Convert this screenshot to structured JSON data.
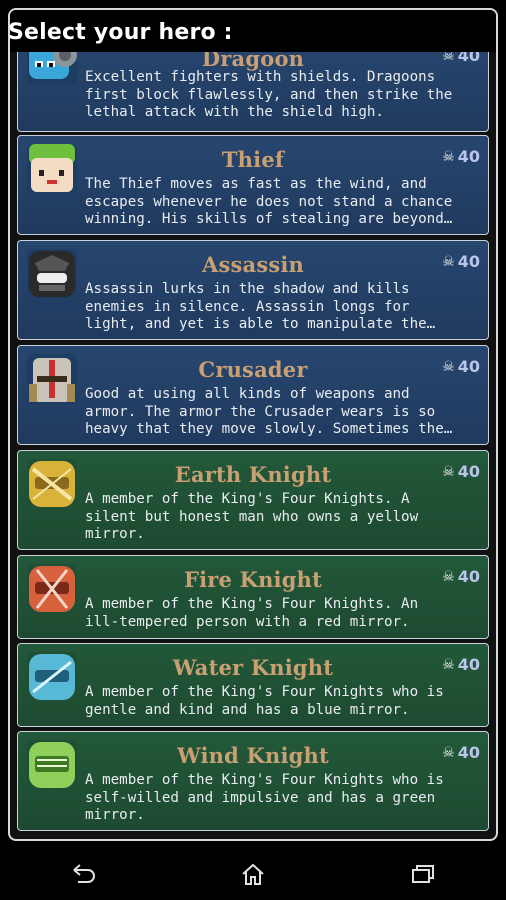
{
  "header": {
    "title": "Select your hero :"
  },
  "heroes": [
    {
      "name": "Dragoon",
      "cost": "40",
      "description": "Excellent fighters with shields. Dragoons\nfirst block flawlessly, and then strike the\nlethal attack with the shield high.",
      "theme": "blue",
      "icon": "dragoon-helmet-icon",
      "avatar_color": "#3aa7d8"
    },
    {
      "name": "Thief",
      "cost": "40",
      "description": "The Thief moves as fast as the wind, and\nescapes whenever he does not stand a chance\nwinning. His skills of stealing are beyond…",
      "theme": "blue",
      "icon": "thief-face-icon",
      "avatar_color": "#6fbf3f"
    },
    {
      "name": "Assassin",
      "cost": "40",
      "description": "Assassin lurks in the shadow and kills\nenemies in silence. Assassin longs for\nlight, and yet is able to manipulate the…",
      "theme": "blue",
      "icon": "assassin-mask-icon",
      "avatar_color": "#2a2a2a"
    },
    {
      "name": "Crusader",
      "cost": "40",
      "description": "Good at using all kinds of weapons and\narmor. The armor the Crusader wears is so\nheavy that they move slowly. Sometimes the…",
      "theme": "blue",
      "icon": "crusader-helmet-icon",
      "avatar_color": "#c9c4b7"
    },
    {
      "name": "Earth Knight",
      "cost": "40",
      "description": "A member of the King's Four Knights. A\nsilent but honest man who owns a yellow\nmirror.",
      "theme": "green",
      "icon": "earth-knight-helmet-icon",
      "avatar_color": "#d9b23a"
    },
    {
      "name": "Fire Knight",
      "cost": "40",
      "description": "A member of the King's Four Knights. An\nill-tempered person with a red mirror.",
      "theme": "green",
      "icon": "fire-knight-helmet-icon",
      "avatar_color": "#d8613d"
    },
    {
      "name": "Water Knight",
      "cost": "40",
      "description": "A member of the King's Four Knights who is\ngentle and kind and has a blue mirror.",
      "theme": "green",
      "icon": "water-knight-helmet-icon",
      "avatar_color": "#58b9d6"
    },
    {
      "name": "Wind Knight",
      "cost": "40",
      "description": "A member of the King's Four Knights who is\nself-willed and impulsive and has a green\nmirror.",
      "theme": "green",
      "icon": "wind-knight-helmet-icon",
      "avatar_color": "#8fd05a"
    }
  ],
  "navigation": {
    "back_icon": "back-icon",
    "home_icon": "home-icon",
    "recents_icon": "recent-apps-icon"
  }
}
